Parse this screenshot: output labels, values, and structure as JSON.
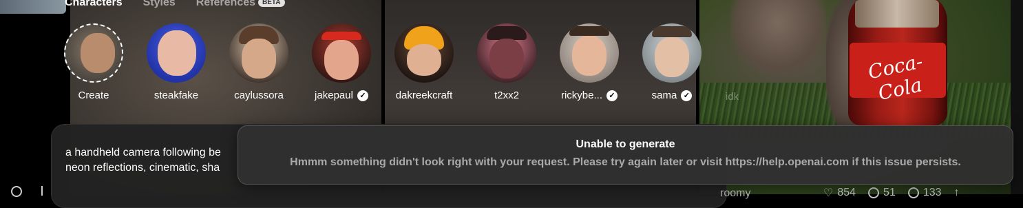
{
  "tabs": [
    {
      "label": "Characters",
      "active": true
    },
    {
      "label": "Styles",
      "active": false
    },
    {
      "label": "References",
      "active": false,
      "badge": "BETA"
    }
  ],
  "characters": [
    {
      "name": "Create",
      "verified": false,
      "type": "create"
    },
    {
      "name": "steakfake",
      "verified": false
    },
    {
      "name": "caylussora",
      "verified": false
    },
    {
      "name": "jakepaul",
      "verified": true
    },
    {
      "name": "dakreekcraft",
      "verified": false
    },
    {
      "name": "t2xx2",
      "verified": false
    },
    {
      "name": "rickybe...",
      "verified": true
    },
    {
      "name": "sama",
      "verified": true
    }
  ],
  "faded_character": "idk",
  "prompt": {
    "text_line1": "a handheld camera following be",
    "text_line2": "neon reflections, cinematic, sha"
  },
  "toast": {
    "title": "Unable to generate",
    "message": "Hmmm something didn't look right with your request. Please try again later or visit https://help.openai.com if this issue persists."
  },
  "video_stats": {
    "author_partial": "roomy",
    "likes": "854",
    "comments": "51",
    "remixes": "133"
  },
  "colors": {
    "toast_bg": "#303030",
    "toast_message": "#a9a9a9",
    "verified_badge": "#ffffff"
  }
}
